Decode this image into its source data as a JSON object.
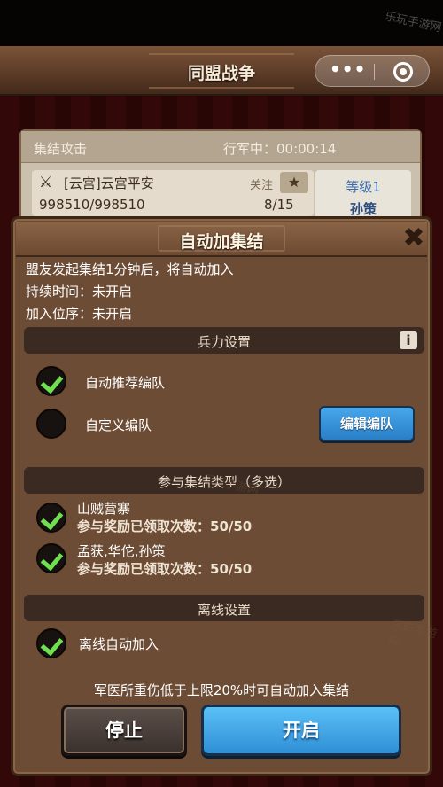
{
  "watermark": "乐玩手游网",
  "header": {
    "title": "同盟战争",
    "more_icon": "more-dots-icon",
    "more_glyph": "•••",
    "close_icon": "target-circle-icon"
  },
  "rally_card": {
    "tab_label": "集结攻击",
    "march_status": "行军中：00:00:14",
    "sword_icon": "sword-icon",
    "leader_name": "[云宫]云宫平安",
    "follow_label": "关注",
    "star_icon": "star-icon",
    "power": "998510/998510",
    "member_count": "8/15",
    "level_label": "等级1",
    "target_name": "孙策"
  },
  "modal": {
    "title": "自动加集结",
    "close_icon": "close-x-icon",
    "close_glyph": "✖",
    "info_lines": [
      "盟友发起集结1分钟后，将自动加入",
      "持续时间：未开启",
      "加入位序：未开启"
    ],
    "troop_section": {
      "title": "兵力设置",
      "info_icon": "info-icon",
      "info_glyph": "i",
      "options": [
        {
          "label": "自动推荐编队",
          "checked": true
        },
        {
          "label": "自定义编队",
          "checked": false
        }
      ],
      "edit_button": "编辑编队"
    },
    "rally_type_section": {
      "title": "参与集结类型（多选）",
      "options": [
        {
          "label": "山贼营寨",
          "sub": "参与奖励已领取次数：50/50",
          "checked": true
        },
        {
          "label": "孟获,华佗,孙策",
          "sub": "参与奖励已领取次数：50/50",
          "checked": true
        }
      ]
    },
    "offline_section": {
      "title": "离线设置",
      "options": [
        {
          "label": "离线自动加入",
          "checked": true
        }
      ]
    },
    "footer_note": "军医所重伤低于上限20%时可自动加入集结",
    "stop_button": "停止",
    "start_button": "开启"
  },
  "colors": {
    "accent_blue": "#3a95dc",
    "check_green": "#6fe04f",
    "panel_brown": "#6d4c36",
    "section_dark": "#3b2a21"
  }
}
